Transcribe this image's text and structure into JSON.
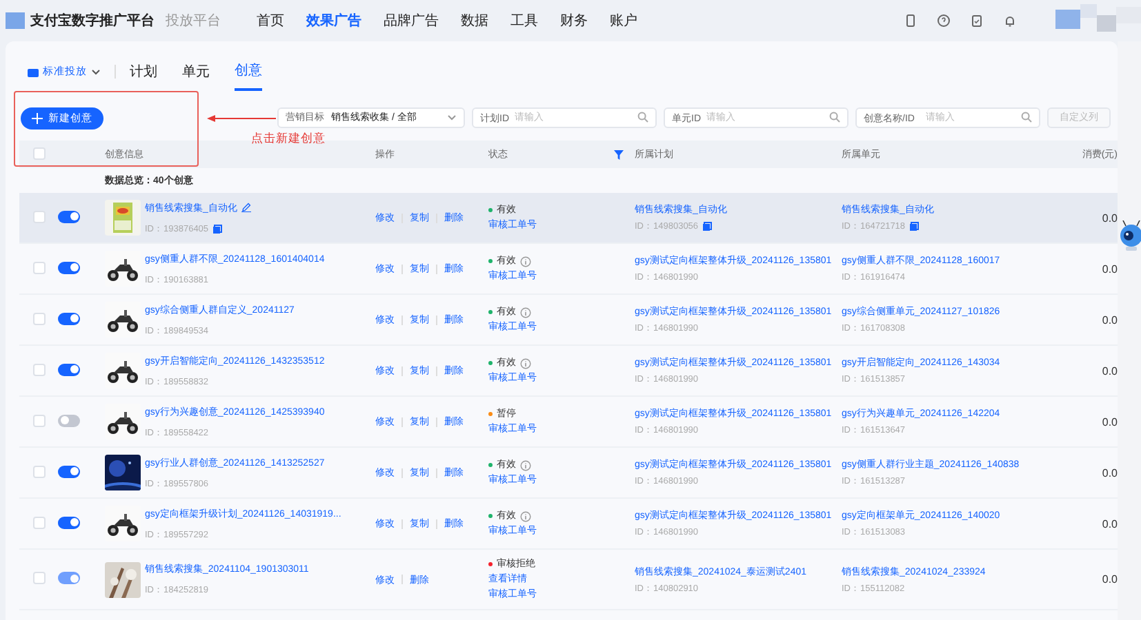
{
  "header": {
    "brand": "支付宝数字推广平台",
    "subtitle": "投放平台",
    "nav": [
      {
        "label": "首页",
        "selected": false
      },
      {
        "label": "效果广告",
        "selected": true
      },
      {
        "label": "品牌广告",
        "selected": false
      },
      {
        "label": "数据",
        "selected": false
      },
      {
        "label": "工具",
        "selected": false
      },
      {
        "label": "财务",
        "selected": false
      },
      {
        "label": "账户",
        "selected": false
      }
    ]
  },
  "mode_select": "标准投放",
  "tabs": [
    {
      "label": "计划",
      "selected": false
    },
    {
      "label": "单元",
      "selected": false
    },
    {
      "label": "创意",
      "selected": true
    }
  ],
  "new_button": "新建创意",
  "annotation": "点击新建创意",
  "filters": [
    {
      "label": "营销目标",
      "value": "销售线索收集 / 全部",
      "kind": "select"
    },
    {
      "label": "计划ID",
      "placeholder": "请输入",
      "kind": "search"
    },
    {
      "label": "单元ID",
      "placeholder": "请输入",
      "kind": "search"
    },
    {
      "label": "创意名称/ID",
      "placeholder": "请输入",
      "kind": "search"
    }
  ],
  "custom_columns_button": "自定义列",
  "table": {
    "select_all": {
      "checked": false
    },
    "columns": [
      "创意信息",
      "操作",
      "状态",
      "所属计划",
      "所属单元",
      "消费(元)"
    ],
    "summary": "数据总览：40个创意",
    "rows": [
      {
        "checked": false,
        "on": true,
        "disabled": false,
        "highlighted": true,
        "name": "销售线索搜集_自动化",
        "editable": true,
        "id": "ID：193876405",
        "copyable": true,
        "actions": [
          "修改",
          "复制",
          "删除"
        ],
        "status": "有效",
        "color": "#1fb36b",
        "info": false,
        "links": [
          "审核工单号"
        ],
        "plan": "销售线索搜集_自动化",
        "plan_id": "ID：149803056",
        "unit": "销售线索搜集_自动化",
        "unit_id": "ID：164721718",
        "cost": "0.0"
      },
      {
        "checked": false,
        "on": true,
        "disabled": false,
        "highlighted": false,
        "name": "gsy侧重人群不限_20241128_1601404014",
        "editable": false,
        "id": "ID：190163881",
        "copyable": false,
        "actions": [
          "修改",
          "复制",
          "删除"
        ],
        "status": "有效",
        "color": "#1fb36b",
        "info": true,
        "links": [
          "审核工单号"
        ],
        "plan": "gsy测试定向框架整体升级_20241126_135801",
        "plan_id": "ID：146801990",
        "unit": "gsy侧重人群不限_20241128_160017",
        "unit_id": "ID：161916474",
        "cost": "0.0"
      },
      {
        "checked": false,
        "on": true,
        "disabled": false,
        "highlighted": false,
        "name": "gsy综合侧重人群自定义_20241127",
        "editable": false,
        "id": "ID：189849534",
        "copyable": false,
        "actions": [
          "修改",
          "复制",
          "删除"
        ],
        "status": "有效",
        "color": "#1fb36b",
        "info": true,
        "links": [
          "审核工单号"
        ],
        "plan": "gsy测试定向框架整体升级_20241126_135801",
        "plan_id": "ID：146801990",
        "unit": "gsy综合侧重单元_20241127_101826",
        "unit_id": "ID：161708308",
        "cost": "0.0"
      },
      {
        "checked": false,
        "on": true,
        "disabled": false,
        "highlighted": false,
        "name": "gsy开启智能定向_20241126_1432353512",
        "editable": false,
        "id": "ID：189558832",
        "copyable": false,
        "actions": [
          "修改",
          "复制",
          "删除"
        ],
        "status": "有效",
        "color": "#1fb36b",
        "info": true,
        "links": [
          "审核工单号"
        ],
        "plan": "gsy测试定向框架整体升级_20241126_135801",
        "plan_id": "ID：146801990",
        "unit": "gsy开启智能定向_20241126_143034",
        "unit_id": "ID：161513857",
        "cost": "0.0"
      },
      {
        "checked": false,
        "on": false,
        "disabled": false,
        "highlighted": false,
        "name": "gsy行为兴趣创意_20241126_1425393940",
        "editable": false,
        "id": "ID：189558422",
        "copyable": false,
        "actions": [
          "修改",
          "复制",
          "删除"
        ],
        "status": "暂停",
        "color": "#fa8c16",
        "info": false,
        "links": [
          "审核工单号"
        ],
        "plan": "gsy测试定向框架整体升级_20241126_135801",
        "plan_id": "ID：146801990",
        "unit": "gsy行为兴趣单元_20241126_142204",
        "unit_id": "ID：161513647",
        "cost": "0.0"
      },
      {
        "checked": false,
        "on": true,
        "disabled": false,
        "highlighted": false,
        "name": "gsy行业人群创意_20241126_1413252527",
        "editable": false,
        "id": "ID：189557806",
        "copyable": false,
        "actions": [
          "修改",
          "复制",
          "删除"
        ],
        "status": "有效",
        "color": "#1fb36b",
        "info": true,
        "links": [
          "审核工单号"
        ],
        "plan": "gsy测试定向框架整体升级_20241126_135801",
        "plan_id": "ID：146801990",
        "unit": "gsy侧重人群行业主题_20241126_140838",
        "unit_id": "ID：161513287",
        "cost": "0.0"
      },
      {
        "checked": false,
        "on": true,
        "disabled": false,
        "highlighted": false,
        "name": "gsy定向框架升级计划_20241126_14031919...",
        "editable": false,
        "id": "ID：189557292",
        "copyable": false,
        "actions": [
          "修改",
          "复制",
          "删除"
        ],
        "status": "有效",
        "color": "#1fb36b",
        "info": true,
        "links": [
          "审核工单号"
        ],
        "plan": "gsy测试定向框架整体升级_20241126_135801",
        "plan_id": "ID：146801990",
        "unit": "gsy定向框架单元_20241126_140020",
        "unit_id": "ID：161513083",
        "cost": "0.0"
      },
      {
        "checked": false,
        "on": true,
        "disabled": true,
        "highlighted": false,
        "name": "销售线索搜集_20241104_1901303011",
        "editable": false,
        "id": "ID：184252819",
        "copyable": false,
        "actions": [
          "修改",
          "删除"
        ],
        "status": "审核拒绝",
        "color": "#f5222d",
        "info": false,
        "links": [
          "查看详情",
          "审核工单号"
        ],
        "plan": "销售线索搜集_20241024_泰运测试2401",
        "plan_id": "ID：140802910",
        "unit": "销售线索搜集_20241024_233924",
        "unit_id": "ID：155112082",
        "cost": "0.0"
      }
    ]
  }
}
